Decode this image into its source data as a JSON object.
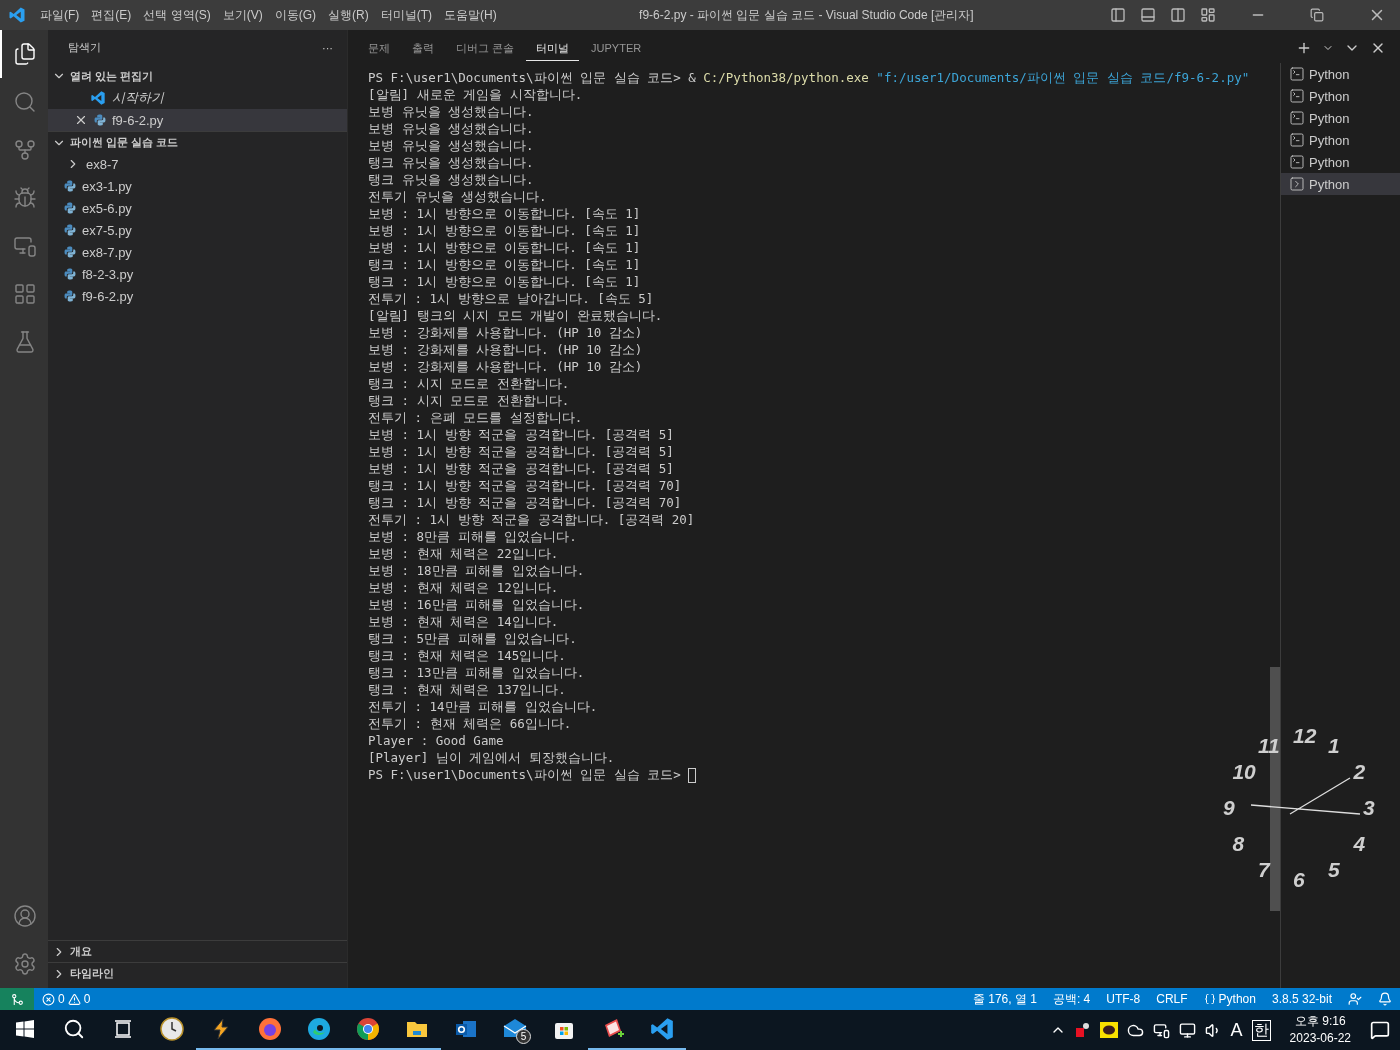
{
  "window": {
    "title": "f9-6-2.py - 파이썬 입문 실습 코드 - Visual Studio Code [관리자]"
  },
  "menu": [
    "파일(F)",
    "편집(E)",
    "선택 영역(S)",
    "보기(V)",
    "이동(G)",
    "실행(R)",
    "터미널(T)",
    "도움말(H)"
  ],
  "activity_bar": [
    {
      "kind": "explorer",
      "selected": true
    },
    {
      "kind": "search",
      "selected": false
    },
    {
      "kind": "source-control",
      "selected": false
    },
    {
      "kind": "run-debug",
      "selected": false
    },
    {
      "kind": "remote",
      "selected": false
    },
    {
      "kind": "extensions",
      "selected": false
    },
    {
      "kind": "testing",
      "selected": false
    }
  ],
  "sidebar": {
    "title": "탐색기",
    "more": "···",
    "open_editors": {
      "title": "열려 있는 편집기",
      "expanded": true,
      "items": [
        {
          "kind": "welcome",
          "label": "시작하기",
          "selected": false
        },
        {
          "kind": "python",
          "label": "f9-6-2.py",
          "selected": true
        }
      ]
    },
    "folder": {
      "title": "파이썬 입문 실습 코드",
      "expanded": true,
      "items": [
        {
          "kind": "folder",
          "label": "ex8-7",
          "expanded": false
        },
        {
          "kind": "python",
          "label": "ex3-1.py"
        },
        {
          "kind": "python",
          "label": "ex5-6.py"
        },
        {
          "kind": "python",
          "label": "ex7-5.py"
        },
        {
          "kind": "python",
          "label": "ex8-7.py"
        },
        {
          "kind": "python",
          "label": "f8-2-3.py"
        },
        {
          "kind": "python",
          "label": "f9-6-2.py"
        }
      ]
    },
    "bottom_sections": [
      {
        "title": "개요",
        "expanded": false
      },
      {
        "title": "타임라인",
        "expanded": false
      }
    ]
  },
  "panel": {
    "tabs": [
      {
        "label": "문제",
        "selected": false
      },
      {
        "label": "출력",
        "selected": false
      },
      {
        "label": "디버그 콘솔",
        "selected": false
      },
      {
        "label": "터미널",
        "selected": true
      },
      {
        "label": "JUPYTER",
        "selected": false
      }
    ],
    "command": {
      "prompt": "PS F:\\user1\\Documents\\파이썬 입문 실습 코드>",
      "operator": "&",
      "executable": "C:/Python38/python.exe",
      "argument": "\"f:/user1/Documents/파이썬 입문 실습 코드/f9-6-2.py\""
    },
    "output": [
      "[알림] 새로운 게임을 시작합니다.",
      "보병 유닛을 생성했습니다.",
      "보병 유닛을 생성했습니다.",
      "보병 유닛을 생성했습니다.",
      "탱크 유닛을 생성했습니다.",
      "탱크 유닛을 생성했습니다.",
      "전투기 유닛을 생성했습니다.",
      "보병 : 1시 방향으로 이동합니다. [속도 1]",
      "보병 : 1시 방향으로 이동합니다. [속도 1]",
      "보병 : 1시 방향으로 이동합니다. [속도 1]",
      "탱크 : 1시 방향으로 이동합니다. [속도 1]",
      "탱크 : 1시 방향으로 이동합니다. [속도 1]",
      "전투기 : 1시 방향으로 날아갑니다. [속도 5]",
      "[알림] 탱크의 시지 모드 개발이 완료됐습니다.",
      "보병 : 강화제를 사용합니다. (HP 10 감소)",
      "보병 : 강화제를 사용합니다. (HP 10 감소)",
      "보병 : 강화제를 사용합니다. (HP 10 감소)",
      "탱크 : 시지 모드로 전환합니다.",
      "탱크 : 시지 모드로 전환합니다.",
      "전투기 : 은폐 모드를 설정합니다.",
      "보병 : 1시 방향 적군을 공격합니다. [공격력 5]",
      "보병 : 1시 방향 적군을 공격합니다. [공격력 5]",
      "보병 : 1시 방향 적군을 공격합니다. [공격력 5]",
      "탱크 : 1시 방향 적군을 공격합니다. [공격력 70]",
      "탱크 : 1시 방향 적군을 공격합니다. [공격력 70]",
      "전투기 : 1시 방향 적군을 공격합니다. [공격력 20]",
      "보병 : 8만큼 피해를 입었습니다.",
      "보병 : 현재 체력은 22입니다.",
      "보병 : 18만큼 피해를 입었습니다.",
      "보병 : 현재 체력은 12입니다.",
      "보병 : 16만큼 피해를 입었습니다.",
      "보병 : 현재 체력은 14입니다.",
      "탱크 : 5만큼 피해를 입었습니다.",
      "탱크 : 현재 체력은 145입니다.",
      "탱크 : 13만큼 피해를 입었습니다.",
      "탱크 : 현재 체력은 137입니다.",
      "전투기 : 14만큼 피해를 입었습니다.",
      "전투기 : 현재 체력은 66입니다.",
      "Player : Good Game",
      "[Player] 님이 게임에서 퇴장했습니다."
    ],
    "final_prompt": "PS F:\\user1\\Documents\\파이썬 입문 실습 코드>",
    "terminals": [
      {
        "label": "Python",
        "selected": false
      },
      {
        "label": "Python",
        "selected": false
      },
      {
        "label": "Python",
        "selected": false
      },
      {
        "label": "Python",
        "selected": false
      },
      {
        "label": "Python",
        "selected": false
      },
      {
        "label": "Python",
        "selected": true
      }
    ]
  },
  "desktop_clock": {
    "numerals": [
      "12",
      "1",
      "2",
      "3",
      "4",
      "5",
      "6",
      "7",
      "8",
      "9",
      "10",
      "11"
    ]
  },
  "status_bar": {
    "problems": {
      "errors": "0",
      "warnings": "0"
    },
    "items": [
      "줄 176, 열 1",
      "공백: 4",
      "UTF-8",
      "CRLF",
      "Python",
      "3.8.5 32-bit"
    ]
  },
  "taskbar": {
    "apps": [
      {
        "kind": "clock",
        "running": false
      },
      {
        "kind": "winamp",
        "running": true
      },
      {
        "kind": "firefox",
        "running": true
      },
      {
        "kind": "edge",
        "running": true
      },
      {
        "kind": "chrome",
        "running": true
      },
      {
        "kind": "explorer",
        "running": true
      },
      {
        "kind": "outlook",
        "running": false
      },
      {
        "kind": "mail",
        "running": false,
        "badge": "5"
      },
      {
        "kind": "store",
        "running": false
      },
      {
        "kind": "notes",
        "running": true
      },
      {
        "kind": "vscode",
        "running": true
      }
    ],
    "tray": {
      "input_mode": "A",
      "ime": "한",
      "time": "오후 9:16",
      "date": "2023-06-22"
    }
  }
}
